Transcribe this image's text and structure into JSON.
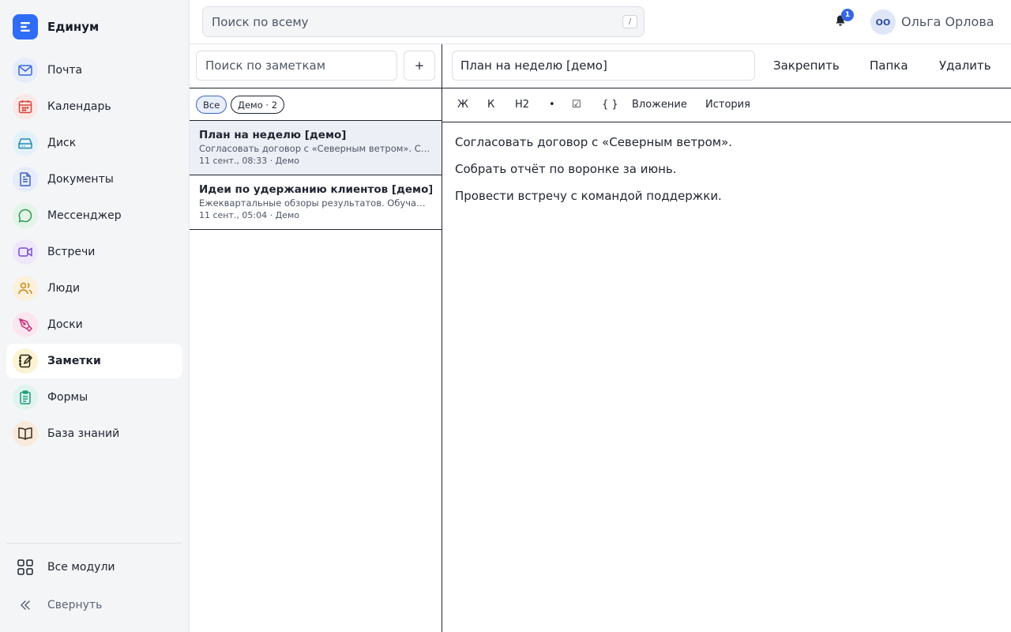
{
  "app": {
    "name": "Единум"
  },
  "header": {
    "search_placeholder": "Поиск по всему",
    "search_shortcut": "/",
    "notifications_count": "1",
    "user_initials": "ОО",
    "user_name": "Ольга Орлова"
  },
  "sidebar": {
    "items": [
      {
        "label": "Почта",
        "icon": "mail-icon",
        "color": "#3766e0",
        "bg": "#e6ecfb"
      },
      {
        "label": "Календарь",
        "icon": "calendar-icon",
        "color": "#d9443a",
        "bg": "#fbe7e5"
      },
      {
        "label": "Диск",
        "icon": "drive-icon",
        "color": "#1f8ab0",
        "bg": "#e2f2f8"
      },
      {
        "label": "Документы",
        "icon": "document-icon",
        "color": "#3f5fbf",
        "bg": "#e6ecfb"
      },
      {
        "label": "Мессенджер",
        "icon": "chat-icon",
        "color": "#2f9a53",
        "bg": "#e3f4e8"
      },
      {
        "label": "Встречи",
        "icon": "video-icon",
        "color": "#7a4fd6",
        "bg": "#efe8fb"
      },
      {
        "label": "Люди",
        "icon": "people-icon",
        "color": "#c98a18",
        "bg": "#fbf0dc"
      },
      {
        "label": "Доски",
        "icon": "pen-icon",
        "color": "#c8327a",
        "bg": "#fbe5ef"
      },
      {
        "label": "Заметки",
        "icon": "notes-icon",
        "color": "#c9a417",
        "bg": "#fbf3d4",
        "active": true
      },
      {
        "label": "Формы",
        "icon": "clipboard-icon",
        "color": "#1f9a7a",
        "bg": "#e0f4ee"
      },
      {
        "label": "База знаний",
        "icon": "book-icon",
        "color": "#b8671f",
        "bg": "#f8eadc"
      }
    ],
    "all_modules": "Все модули",
    "collapse": "Свернуть"
  },
  "notes": {
    "search_placeholder": "Поиск по заметкам",
    "add_label": "+",
    "filters": {
      "all": "Все",
      "demo": "Демо · 2"
    },
    "items": [
      {
        "title": "План на неделю [демо]",
        "snippet": "Согласовать договор с «Северным ветром». Со…",
        "meta": "11 сент., 08:33 · Демо",
        "selected": true
      },
      {
        "title": "Идеи по удержанию клиентов [демо]",
        "snippet": "Ежеквартальные обзоры результатов. Обучаю…",
        "meta": "11 сент., 05:04 · Демо"
      }
    ]
  },
  "editor": {
    "title": "План на неделю [демо]",
    "actions": {
      "pin": "Закрепить",
      "folder": "Папка",
      "delete": "Удалить"
    },
    "toolbar": {
      "bold": "Ж",
      "italic": "К",
      "h2": "H2",
      "bullet": "•",
      "checklist": "☑",
      "code": "{ }",
      "attachment": "Вложение",
      "history": "История"
    },
    "paragraphs": [
      "Согласовать договор с «Северным ветром».",
      "Собрать отчёт по воронке за июнь.",
      "Провести встречу с командой поддержки."
    ]
  }
}
